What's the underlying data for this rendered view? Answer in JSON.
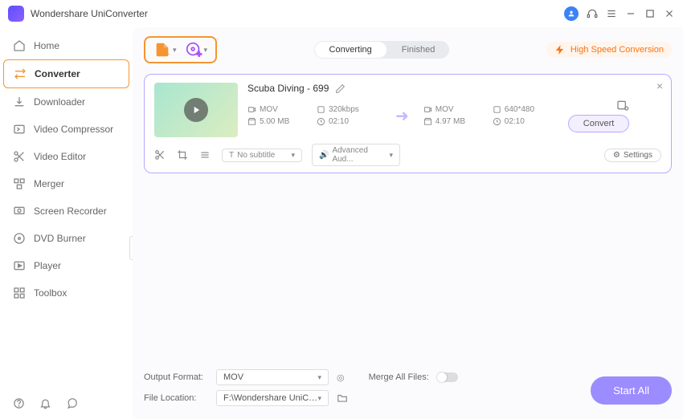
{
  "app": {
    "name": "Wondershare UniConverter"
  },
  "sidebar": {
    "items": [
      {
        "label": "Home"
      },
      {
        "label": "Converter"
      },
      {
        "label": "Downloader"
      },
      {
        "label": "Video Compressor"
      },
      {
        "label": "Video Editor"
      },
      {
        "label": "Merger"
      },
      {
        "label": "Screen Recorder"
      },
      {
        "label": "DVD Burner"
      },
      {
        "label": "Player"
      },
      {
        "label": "Toolbox"
      }
    ]
  },
  "tabs": {
    "converting": "Converting",
    "finished": "Finished"
  },
  "highspeed": "High Speed Conversion",
  "file": {
    "title": "Scuba Diving - 699",
    "src": {
      "format": "MOV",
      "bitrate": "320kbps",
      "size": "5.00 MB",
      "duration": "02:10"
    },
    "dst": {
      "format": "MOV",
      "resolution": "640*480",
      "size": "4.97 MB",
      "duration": "02:10"
    },
    "subtitle": "No subtitle",
    "audio": "Advanced Aud...",
    "settings": "Settings",
    "convert": "Convert"
  },
  "footer": {
    "outputFormatLabel": "Output Format:",
    "outputFormat": "MOV",
    "mergeLabel": "Merge All Files:",
    "fileLocationLabel": "File Location:",
    "fileLocation": "F:\\Wondershare UniConverter",
    "startAll": "Start All"
  }
}
